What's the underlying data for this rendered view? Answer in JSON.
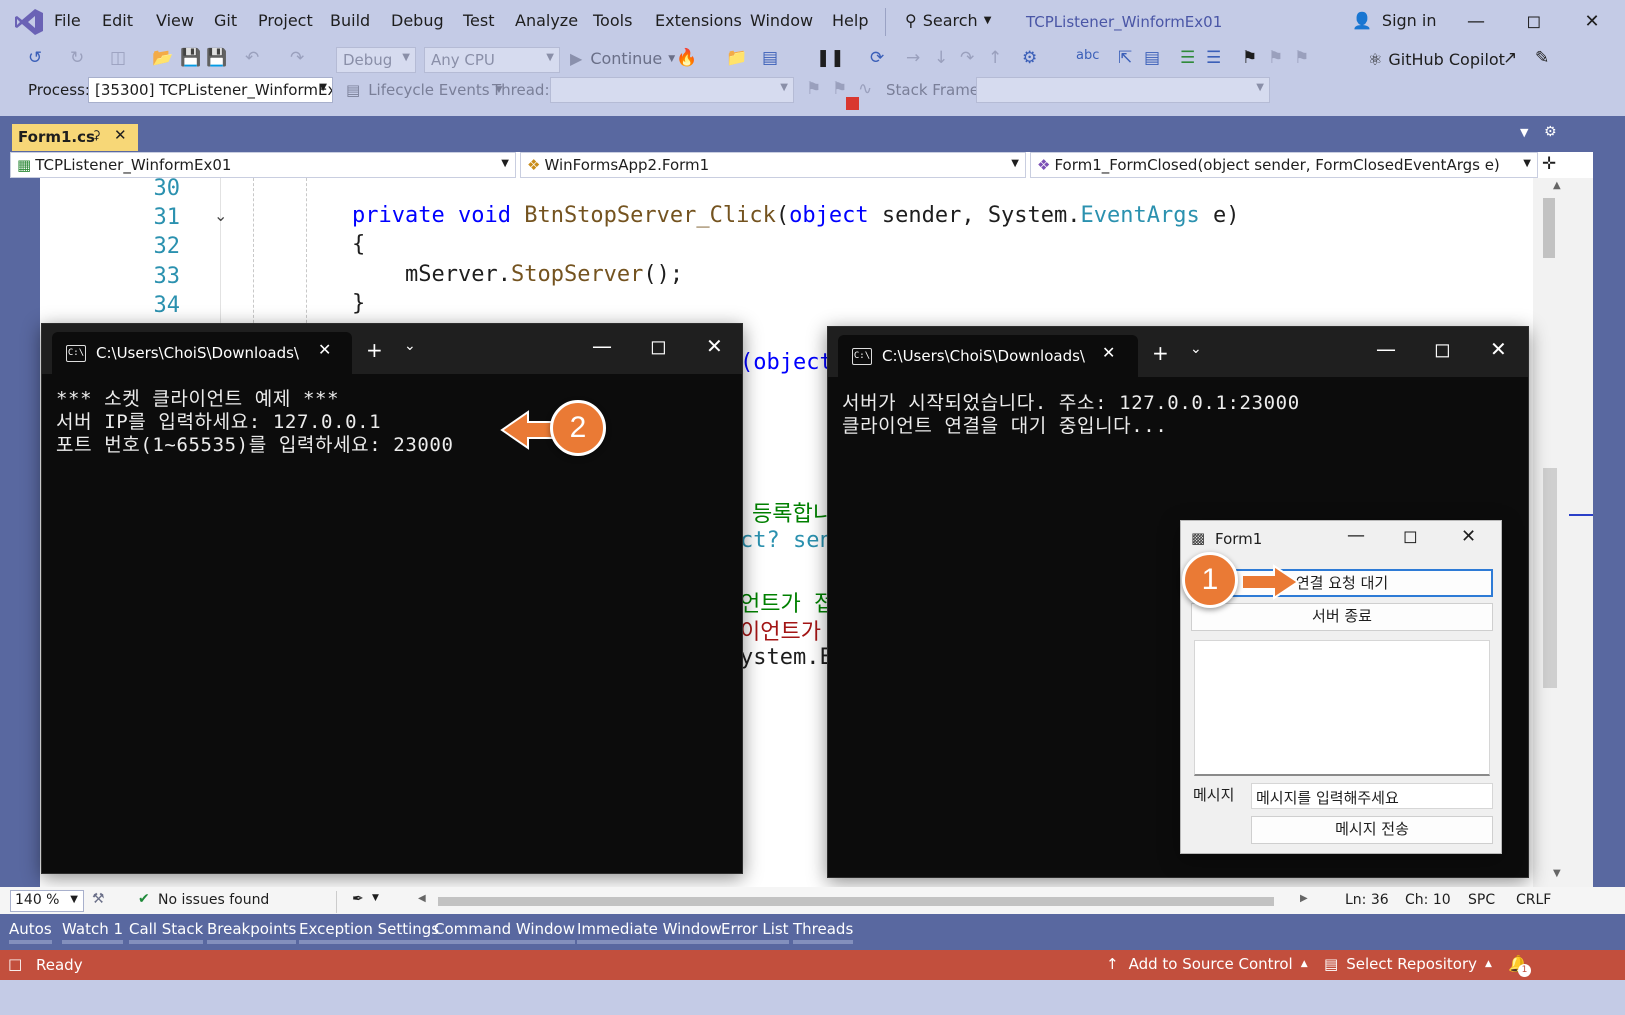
{
  "menu": [
    "File",
    "Edit",
    "View",
    "Git",
    "Project",
    "Build",
    "Debug",
    "Test",
    "Analyze",
    "Tools",
    "Extensions",
    "Window",
    "Help"
  ],
  "search_label": "Search",
  "solution_title": "TCPListener_WinformEx01",
  "sign_in": "Sign in",
  "toolbar": {
    "config": "Debug",
    "platform": "Any CPU",
    "continue": "Continue",
    "copilot": "GitHub Copilot"
  },
  "debugbar": {
    "process_label": "Process:",
    "process_value": "[35300] TCPListener_WinformEx01",
    "lifecycle": "Lifecycle Events",
    "thread_label": "Thread:",
    "stackframe_label": "Stack Frame:"
  },
  "doc_tab": "Form1.cs",
  "nav": {
    "project": "TCPListener_WinformEx01",
    "class": "WinFormsApp2.Form1",
    "member": "Form1_FormClosed(object sender, FormClosedEventArgs e)"
  },
  "code": {
    "lines": [
      "30",
      "31",
      "32",
      "33",
      "34"
    ],
    "l31_kw1": "private",
    "l31_kw2": "void",
    "l31_method": "BtnStopServer_Click",
    "l31_p1": "(",
    "l31_kw3": "object",
    "l31_p2": " sender, System.",
    "l31_type": "EventArgs",
    "l31_p3": " e)",
    "l32": "{",
    "l33_a": "mServer.",
    "l33_m": "StopServer",
    "l33_b": "();",
    "l34": "}",
    "frag_object": "(object",
    "frag_reg": "등록합니",
    "frag_sen": "ct? sen",
    "frag_ent": "언트가 접",
    "frag_ient": "이언트가",
    "frag_sys": "ystem.E"
  },
  "console_left": {
    "tab": "C:\\Users\\ChoiS\\Downloads\\",
    "lines": [
      "*** 소켓 클라이언트 예제 ***",
      "서버 IP를 입력하세요: 127.0.0.1",
      "포트 번호(1~65535)를 입력하세요: 23000"
    ]
  },
  "console_right": {
    "tab": "C:\\Users\\ChoiS\\Downloads\\",
    "lines": [
      "서버가 시작되었습니다. 주소: 127.0.0.1:23000",
      "클라이언트 연결을 대기 중입니다..."
    ]
  },
  "form1": {
    "title": "Form1",
    "btn_wait": "연결 요청 대기",
    "btn_stop": "서버 종료",
    "msg_label": "메시지",
    "msg_placeholder": "메시지를 입력해주세요",
    "btn_send": "메시지 전송"
  },
  "badges": [
    "1",
    "2"
  ],
  "editor_status": {
    "zoom": "140 %",
    "issues": "No issues found",
    "ln": "Ln: 36",
    "ch": "Ch: 10",
    "spc": "SPC",
    "crlf": "CRLF"
  },
  "tool_tabs": [
    "Autos",
    "Watch 1",
    "Call Stack",
    "Breakpoints",
    "Exception Settings",
    "Command Window",
    "Immediate Window",
    "Error List",
    "Threads"
  ],
  "statusbar": {
    "ready": "Ready",
    "source_control": "Add to Source Control",
    "repo": "Select Repository",
    "notif_count": "1"
  },
  "colors": {
    "accent": "#ea7a35",
    "status": "#c24f3d",
    "chrome": "#c4cbe6",
    "console": "#0c0c0c"
  }
}
